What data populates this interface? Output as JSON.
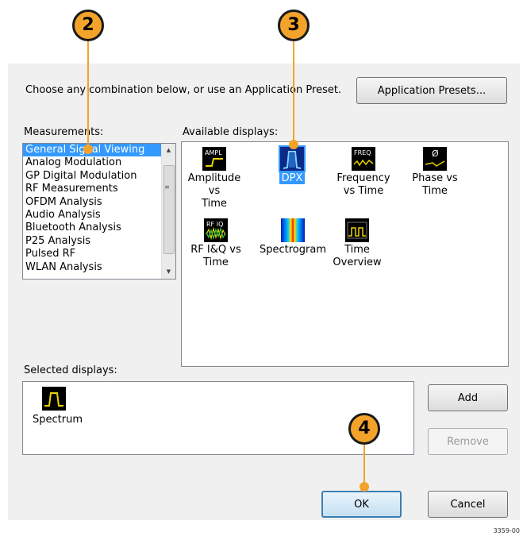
{
  "dialog": {
    "instruction": "Choose any combination below, or use an Application Preset.",
    "presets_button": "Application Presets...",
    "measurements_label": "Measurements:",
    "available_label": "Available displays:",
    "selected_label": "Selected displays:",
    "add_button": "Add",
    "remove_button": "Remove",
    "ok_button": "OK",
    "cancel_button": "Cancel"
  },
  "measurements": [
    {
      "label": "General Signal Viewing",
      "selected": true
    },
    {
      "label": "Analog Modulation"
    },
    {
      "label": "GP Digital Modulation"
    },
    {
      "label": "RF Measurements"
    },
    {
      "label": "OFDM Analysis"
    },
    {
      "label": "Audio Analysis"
    },
    {
      "label": "Bluetooth Analysis"
    },
    {
      "label": "P25 Analysis"
    },
    {
      "label": "Pulsed RF"
    },
    {
      "label": "WLAN Analysis"
    }
  ],
  "available_displays": [
    {
      "line1": "Amplitude vs",
      "line2": "Time",
      "icon": "ampl-icon",
      "icon_text": "AMPL"
    },
    {
      "line1": "DPX",
      "line2": "",
      "icon": "dpx-icon",
      "selected": true
    },
    {
      "line1": "Frequency",
      "line2": "vs Time",
      "icon": "freq-icon",
      "icon_text": "FREQ"
    },
    {
      "line1": "Phase vs",
      "line2": "Time",
      "icon": "phase-icon",
      "icon_text": "Ø"
    },
    {
      "line1": "RF I&Q vs",
      "line2": "Time",
      "icon": "rfiq-icon",
      "icon_text": "RF IQ"
    },
    {
      "line1": "Spectrogram",
      "line2": "",
      "icon": "spectrogram-icon"
    },
    {
      "line1": "Time",
      "line2": "Overview",
      "icon": "time-overview-icon"
    }
  ],
  "selected_displays": [
    {
      "label": "Spectrum",
      "icon": "spectrum-icon"
    }
  ],
  "callouts": [
    "2",
    "3",
    "4"
  ],
  "figure_number": "3359-00",
  "colors": {
    "callout": "#f4a32a",
    "selection": "#3399ff",
    "dialog_bg": "#f0f0f0"
  }
}
